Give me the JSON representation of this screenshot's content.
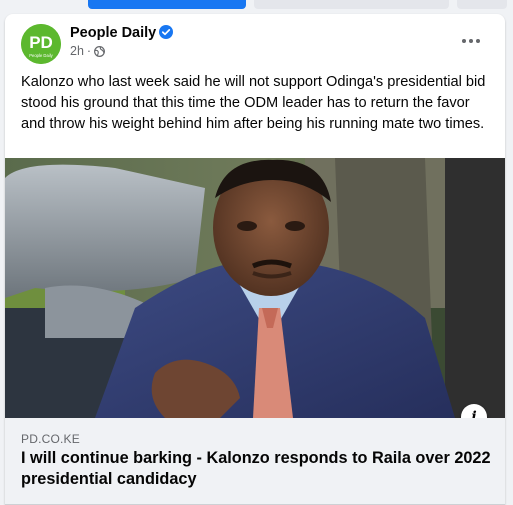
{
  "post": {
    "page_name": "People Daily",
    "timestamp": "2h",
    "separator": "·",
    "audience_icon": "globe-icon",
    "avatar_text": "PD",
    "avatar_subtext": "People Daily",
    "body": "Kalonzo who last week said he will not support Odinga's presidential bid stood his ground that this time the ODM leader has to return the favor and throw his weight behind him after being his running mate two times."
  },
  "link_preview": {
    "domain": "PD.CO.KE",
    "headline": "I will continue barking - Kalonzo responds to Raila over 2022 presidential candidacy",
    "info_label": "i"
  },
  "colors": {
    "brand_blue": "#1877f2",
    "avatar_green": "#5cb82e",
    "footer_bg": "#f0f2f5",
    "meta_gray": "#65676b"
  }
}
